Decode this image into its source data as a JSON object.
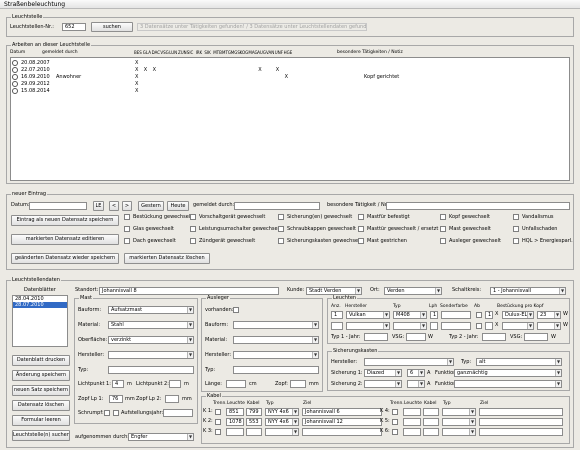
{
  "window": {
    "title": "Straßenbeleuchtung"
  },
  "search": {
    "group": "Leuchtstelle",
    "label": "Leuchtstellen-Nr.:",
    "value": "652",
    "button": "suchen",
    "status": "3 Datensätze unter Tätigkeiten gefunden! / 3 Datensätze unter Leuchtstellendaten gefunden!"
  },
  "work": {
    "group": "Arbeiten an dieser Leuchtstelle",
    "columns": {
      "datum": "Datum",
      "gemeldet": "gemeldet durch",
      "codes": [
        "BES",
        "GLA",
        "DAC",
        "VSG",
        "LUN",
        "ZUN",
        "SIC",
        "IRK",
        "SIK",
        "MTB",
        "MTG",
        "MGS",
        "KOG",
        "MAG",
        "AUG",
        "VAN",
        "UNF",
        "HGE"
      ],
      "notes": "besondere Tätigkeiten / Notiz"
    },
    "rows": [
      {
        "date": "20.08.2007",
        "by": "",
        "marks": [
          1,
          0,
          0,
          0,
          0,
          0,
          0,
          0,
          0,
          0,
          0,
          0,
          0,
          0,
          0,
          0,
          0,
          0
        ],
        "note": ""
      },
      {
        "date": "22.07.2010",
        "by": "",
        "marks": [
          1,
          1,
          1,
          0,
          0,
          0,
          0,
          0,
          0,
          0,
          0,
          0,
          0,
          0,
          1,
          0,
          1,
          0
        ],
        "note": ""
      },
      {
        "date": "16.09.2010",
        "by": "Anwohner",
        "marks": [
          1,
          0,
          0,
          0,
          0,
          0,
          0,
          0,
          0,
          0,
          0,
          0,
          0,
          0,
          0,
          0,
          0,
          1
        ],
        "note": "Kopf gerichtet"
      },
      {
        "date": "29.09.2012",
        "by": "",
        "marks": [
          1,
          0,
          0,
          0,
          0,
          0,
          0,
          0,
          0,
          0,
          0,
          0,
          0,
          0,
          0,
          0,
          0,
          0
        ],
        "note": ""
      },
      {
        "date": "15.08.2014",
        "by": "",
        "marks": [
          1,
          0,
          0,
          0,
          0,
          0,
          0,
          0,
          0,
          0,
          0,
          0,
          0,
          0,
          0,
          0,
          0,
          0
        ],
        "note": ""
      }
    ]
  },
  "entry": {
    "group": "neuer Eintrag",
    "datum_label": "Datum:",
    "cal_button": "LE",
    "prev": "<",
    "next": ">",
    "gestern": "Gestern",
    "heute": "Heute",
    "gemeldet_label": "gemeldet durch:",
    "besondere_label": "besondere Tätigkeit / Notiz:",
    "buttons": [
      "Eintrag als neuen Datensatz speichern",
      "markierten Datensatz editieren",
      "geänderten Datensatz wieder speichern",
      "markierten Datensatz löschen"
    ],
    "checks": [
      [
        "Bestückung gewechselt",
        "Glas gewechselt",
        "Dach gewechselt"
      ],
      [
        "Vorschaltgerät gewechselt",
        "Leistungsumschalter gewechselt",
        "Zündgerät gewechselt"
      ],
      [
        "Sicherung(en) gewechselt",
        "Schraubkappen gewechselt",
        "Sicherungskasten gewechselt"
      ],
      [
        "Mastfür befestigt",
        "Masttür gewechselt / ersetzt",
        "Mast gestrichen"
      ],
      [
        "Kopf gewechselt",
        "Mast gewechselt",
        "Ausleger gewechselt"
      ],
      [
        "Vandalismus",
        "Unfallschaden",
        "HQL > Energiesparl."
      ]
    ]
  },
  "data": {
    "group": "Leuchtstellendaten",
    "blaetter_label": "Datenblätter",
    "blaetter": [
      "28.04.2010",
      "28.07.2010"
    ],
    "side_buttons": [
      "Datenblatt drucken",
      "Änderung speichern",
      "neuen Satz speichern",
      "Datensatz löschen",
      "Formular leeren",
      "Leuchtstelle(n) suchen"
    ],
    "standort_label": "Standort:",
    "standort": "Johannisvall 8",
    "kunde_label": "Kunde:",
    "kunde": "Stadt Verden",
    "ort_label": "Ort:",
    "ort": "Verden",
    "schaltkreis_label": "Schaltkreis:",
    "schaltkreis": "1 - Johannisvall",
    "mast": {
      "group": "Mast",
      "bauform_label": "Bauform:",
      "bauform": "Aufsatzmast",
      "material_label": "Material:",
      "material": "Stahl",
      "oberflaeche_label": "Oberfläche:",
      "oberflaeche": "verzinkt",
      "hersteller_label": "Hersteller:",
      "hersteller": "",
      "typ_label": "Typ:",
      "typ": "",
      "lp1_label": "Lichtpunkt 1:",
      "lp1": "4",
      "lp2_label": "Lichtpunkt 2:",
      "lp2": "",
      "unit_m": "m",
      "zopf1_label": "Zopf Lp 1:",
      "zopf1": "76",
      "zopf2_label": "Zopf Lp 2:",
      "zopf2": "",
      "unit_mm": "mm",
      "schrumpf_label": "Schrumpf:",
      "aufstellung_label": "Aufstellungsjahr:",
      "aufstellung": ""
    },
    "ausleger": {
      "group": "Ausleger",
      "vorhanden_label": "vorhanden:",
      "bauform_label": "Bauform:",
      "material_label": "Material:",
      "hersteller_label": "Hersteller:",
      "typ_label": "Typ:",
      "laenge_label": "Länge:",
      "unit_cm": "cm",
      "zopf_label": "Zopf:",
      "unit_mm": "mm"
    },
    "leuchten": {
      "group": "Leuchten",
      "cols": [
        "Anz.",
        "Hersteller",
        "Typ",
        "Lph",
        "Sonderfarbe",
        "Ab",
        "",
        "Bestückung pro Kopf"
      ],
      "row1": {
        "anz": "1",
        "hersteller": "Vulkan",
        "typ": "M408",
        "lph": "1",
        "nr": "1",
        "x": "X",
        "bestueckung": "Dulux-EL",
        "watt": "23",
        "w": "W"
      },
      "typ1_label": "Typ 1 - Jahr:",
      "vsg_label": "VSG:",
      "w_label": "W",
      "typ2_label": "Typ 2 - Jahr:"
    },
    "sicherung": {
      "group": "Sicherungskasten",
      "hersteller_label": "Hersteller:",
      "typ_label": "Typ:",
      "typ": "alt",
      "s1_label": "Sicherung 1:",
      "s1": "Diazed",
      "s1_a": "6",
      "a_label": "A",
      "funktion_label": "Funktion:",
      "funktion": "ganznächtig",
      "s2_label": "Sicherung 2:"
    },
    "kabel": {
      "group": "Kabel",
      "cols": [
        "Trenn.",
        "Leuchte",
        "Kabel",
        "Typ",
        "Ziel"
      ],
      "rows": [
        {
          "k": "K 1:",
          "leuchte": "851",
          "kabel": "799",
          "typ": "NYY 4x6",
          "ziel": "Johannisvall 6"
        },
        {
          "k": "K 2:",
          "leuchte": "1078",
          "kabel": "553",
          "typ": "NYY 4x6",
          "ziel": "Johannisvall 12"
        },
        {
          "k": "K 3:",
          "leuchte": "",
          "kabel": "",
          "typ": "",
          "ziel": ""
        }
      ],
      "rows2": [
        "K 4:",
        "K 5:",
        "K 6:"
      ]
    },
    "aufgenommen_label": "aufgenommen durch:",
    "aufgenommen": "Engfer"
  }
}
